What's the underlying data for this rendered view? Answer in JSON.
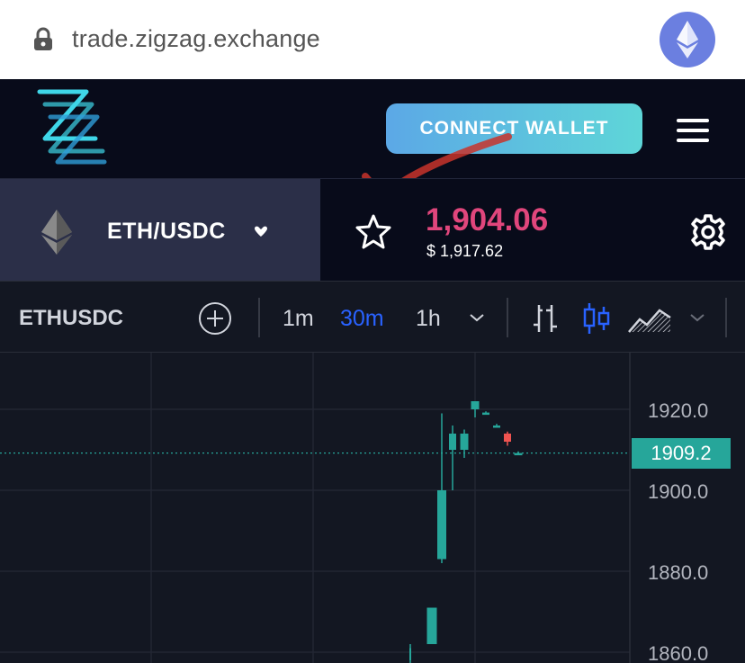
{
  "browser": {
    "url": "trade.zigzag.exchange",
    "lock_icon": "lock-icon",
    "badge_icon": "ethereum-icon"
  },
  "header": {
    "logo_icon": "zigzag-logo",
    "connect_label": "CONNECT WALLET",
    "menu_icon": "hamburger-menu-icon"
  },
  "market": {
    "pair": "ETH/USDC",
    "pair_icon": "ethereum-icon",
    "price": "1,904.06",
    "usd_price": "$ 1,917.62",
    "price_color": "#e0467c"
  },
  "chart_toolbar": {
    "symbol": "ETHUSDC",
    "timeframes": [
      "1m",
      "30m",
      "1h"
    ],
    "active_timeframe": "30m",
    "chart_types": [
      "bars-icon",
      "candles-icon",
      "area-icon"
    ],
    "active_chart_type": "candles-icon"
  },
  "chart_data": {
    "type": "candlestick",
    "y_ticks": [
      "1920.0",
      "1900.0",
      "1880.0",
      "1860.0"
    ],
    "ylim": [
      1856,
      1926
    ],
    "last_price": "1909.2",
    "up_color": "#26a69a",
    "down_color": "#ef5350",
    "candles": [
      {
        "o": 1858,
        "h": 1862,
        "l": 1856,
        "c": 1861,
        "dir": "up"
      },
      {
        "o": 1862,
        "h": 1871,
        "l": 1862,
        "c": 1871,
        "dir": "up"
      },
      {
        "o": 1883,
        "h": 1919,
        "l": 1882,
        "c": 1900,
        "dir": "up"
      },
      {
        "o": 1910,
        "h": 1916,
        "l": 1900,
        "c": 1914,
        "dir": "up"
      },
      {
        "o": 1910,
        "h": 1915,
        "l": 1908,
        "c": 1914,
        "dir": "up"
      },
      {
        "o": 1920,
        "h": 1922,
        "l": 1918,
        "c": 1922,
        "dir": "up"
      },
      {
        "o": 1919,
        "h": 1919.5,
        "l": 1918.7,
        "c": 1919.2,
        "dir": "up"
      },
      {
        "o": 1916,
        "h": 1916.4,
        "l": 1915.6,
        "c": 1915.8,
        "dir": "up"
      },
      {
        "o": 1914,
        "h": 1914.5,
        "l": 1911,
        "c": 1912,
        "dir": "down"
      },
      {
        "o": 1909,
        "h": 1909.6,
        "l": 1908.8,
        "c": 1909.2,
        "dir": "up"
      }
    ]
  }
}
